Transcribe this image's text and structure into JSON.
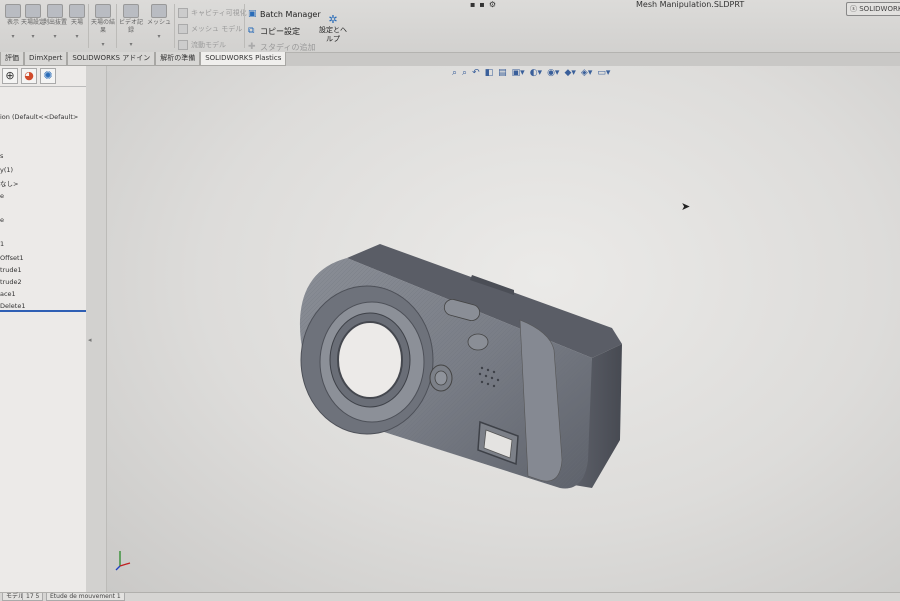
{
  "window": {
    "file_title": "Mesh Manipulation.SLDPRT",
    "brand_label": "SOLIDWORKS"
  },
  "ribbon": {
    "buttons": [
      {
        "label": "表示",
        "icon": "view-icon"
      },
      {
        "label": "天場設定",
        "icon": "settings-icon"
      },
      {
        "label": "剥出抜置",
        "icon": "extract-icon"
      },
      {
        "label": "天場",
        "icon": "field-icon"
      },
      {
        "label": "天場の結果",
        "icon": "results-icon"
      },
      {
        "label": "ビデオ記録",
        "icon": "video-icon"
      },
      {
        "label": "メッシュ",
        "icon": "mesh-icon"
      }
    ],
    "disabled_commands": [
      "キャビティ可視化",
      "メッシュ モデル",
      "流動モデル"
    ],
    "commands": [
      "Batch Manager",
      "コピー設定",
      "スタディの追加"
    ],
    "settings_help_label": "設定とヘルプ"
  },
  "tabs": [
    "評価",
    "DimXpert",
    "SOLIDWORKS アドイン",
    "解析の準備",
    "SOLIDWORKS Plastics"
  ],
  "active_tab": "SOLIDWORKS Plastics",
  "feature_tree": {
    "config_label": "ion (Default<<Default>",
    "items": [
      "s",
      "y(1)",
      "なし>",
      "e",
      "e",
      "1",
      "Offset1",
      "trude1",
      "trude2",
      "ace1",
      "Delete1"
    ]
  },
  "status_bar": {
    "tabs": [
      "モデル",
      "17 5",
      "Etude de mouvement 1"
    ]
  },
  "viewport": {
    "background_color": "#e4e3e1",
    "model_color": "#7c8088"
  }
}
